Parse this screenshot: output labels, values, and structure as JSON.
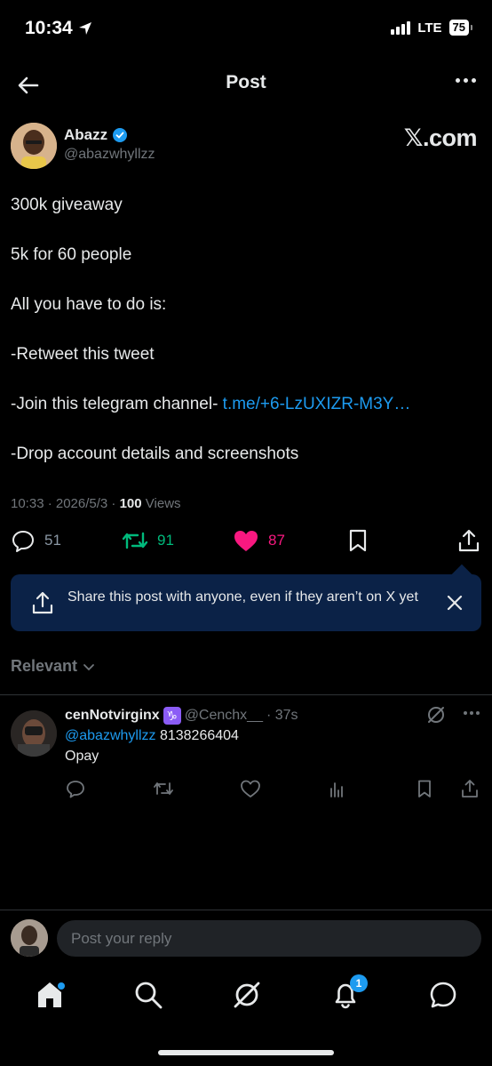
{
  "status_bar": {
    "time": "10:34",
    "network": "LTE",
    "battery": "75"
  },
  "header": {
    "title": "Post"
  },
  "author": {
    "name": "Abazz",
    "handle": "@abazwhyllzz",
    "source": "𝕏.com"
  },
  "tweet": {
    "lines": [
      "300k giveaway",
      "5k for 60 people",
      "All you have to do is:",
      "-Retweet this tweet",
      "-Join this telegram channel- ",
      "-Drop account details and screenshots"
    ],
    "link": "t.me/+6-LzUXIZR-M3Y…",
    "time": "10:33 · 2026/5/3 · ",
    "views": "100",
    "views_label": " Views"
  },
  "actions": {
    "replies": "51",
    "retweets": "91",
    "likes": "87"
  },
  "share_banner": {
    "text": "Share this post with anyone, even if they aren’t on X yet"
  },
  "sort": {
    "label": "Relevant"
  },
  "reply": {
    "name": "cenNotvirginx",
    "zodiac": "♑",
    "handle": "@Cenchx__",
    "time": " · 37s",
    "mention": "@abazwhyllzz",
    "number": " 8138266404",
    "text": "Opay"
  },
  "compose": {
    "placeholder": "Post your reply"
  },
  "tabbar": {
    "notifications_badge": "1"
  },
  "colors": {
    "accent": "#1d9bf0",
    "retweet": "#00ba7c",
    "like": "#f91880",
    "banner": "#0b2247"
  },
  "icons": [
    "back-arrow-icon",
    "more-icon",
    "verified-icon",
    "reply-icon",
    "retweet-icon",
    "heart-icon",
    "bookmark-icon",
    "share-icon",
    "close-icon",
    "grok-icon",
    "analytics-icon",
    "home-icon",
    "search-icon",
    "bell-icon",
    "messages-icon"
  ]
}
